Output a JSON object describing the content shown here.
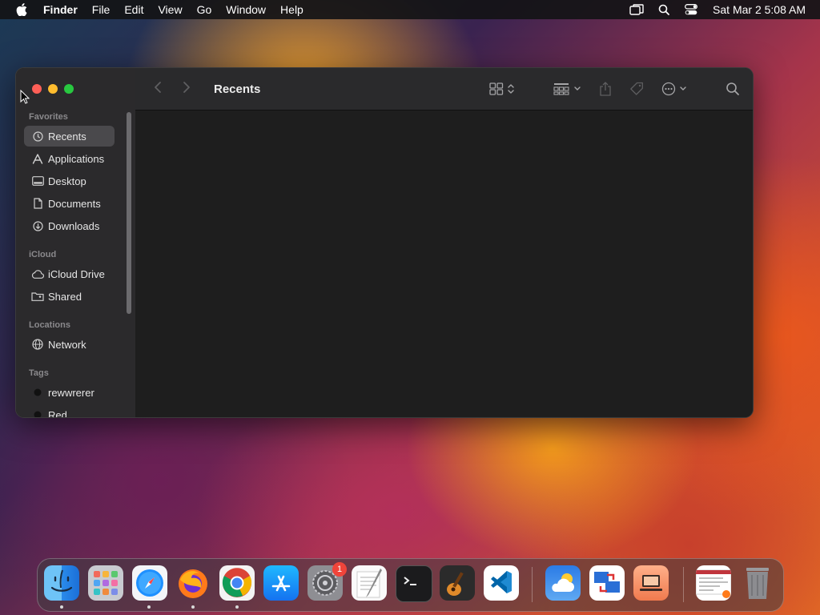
{
  "menubar": {
    "apple_icon": "apple-logo-icon",
    "app_name": "Finder",
    "menus": [
      "File",
      "Edit",
      "View",
      "Go",
      "Window",
      "Help"
    ],
    "clock": "Sat Mar 2  5:08 AM"
  },
  "window": {
    "title": "Recents",
    "sidebar": {
      "sections": {
        "favorites": "Favorites",
        "icloud": "iCloud",
        "locations": "Locations",
        "tags": "Tags"
      },
      "favorites": [
        "Recents",
        "Applications",
        "Desktop",
        "Documents",
        "Downloads"
      ],
      "icloud_items": [
        "iCloud Drive",
        "Shared"
      ],
      "locations": [
        "Network"
      ],
      "tags": [
        "rewwrerer",
        "Red"
      ],
      "selected": "Recents"
    }
  },
  "dock": {
    "apps": [
      {
        "name": "Finder",
        "running": true
      },
      {
        "name": "Launchpad",
        "running": false
      },
      {
        "name": "Safari",
        "running": true
      },
      {
        "name": "Firefox",
        "running": true
      },
      {
        "name": "Google Chrome",
        "running": true
      },
      {
        "name": "App Store",
        "running": false
      },
      {
        "name": "System Settings",
        "running": false,
        "badge": "1"
      },
      {
        "name": "TextEdit",
        "running": false
      },
      {
        "name": "Terminal",
        "running": false
      },
      {
        "name": "GarageBand",
        "running": false
      },
      {
        "name": "Visual Studio Code",
        "running": false
      },
      {
        "name": "Weather",
        "running": false
      },
      {
        "name": "Migration Assistant",
        "running": false
      },
      {
        "name": "Screen Sharing",
        "running": false
      },
      {
        "name": "Recent Document",
        "running": false
      },
      {
        "name": "Trash",
        "running": false
      }
    ]
  }
}
